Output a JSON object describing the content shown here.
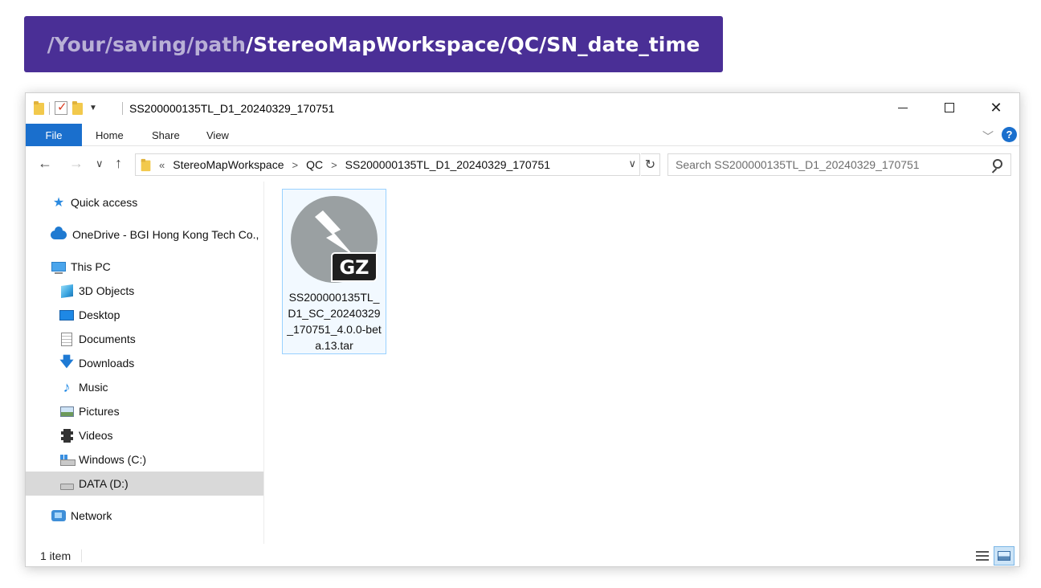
{
  "banner": {
    "prefix": "/Your/saving/path",
    "suffix": "/StereoMapWorkspace/QC/SN_date_time"
  },
  "window": {
    "title": "SS200000135TL_D1_20240329_170751",
    "controls": {
      "minimize": "—",
      "maximize": "☐",
      "close": "✕"
    }
  },
  "ribbon": {
    "tabs": [
      "File",
      "Home",
      "Share",
      "View"
    ],
    "help": "?"
  },
  "address": {
    "overflow": "«",
    "breadcrumbs": [
      "StereoMapWorkspace",
      "QC",
      "SS200000135TL_D1_20240329_170751"
    ],
    "search_placeholder": "Search SS200000135TL_D1_20240329_170751"
  },
  "navpane": {
    "quick_access": "Quick access",
    "onedrive": "OneDrive - BGI Hong Kong Tech Co.,",
    "this_pc": "This PC",
    "items": [
      "3D Objects",
      "Desktop",
      "Documents",
      "Downloads",
      "Music",
      "Pictures",
      "Videos",
      "Windows (C:)",
      "DATA (D:)"
    ],
    "network": "Network",
    "selected": "DATA (D:)"
  },
  "content": {
    "files": [
      {
        "name": "SS200000135TL_D1_SC_20240329_170751_4.0.0-beta.13.tar",
        "badge": "GZ",
        "icon": "gz-archive-icon"
      }
    ]
  },
  "status": {
    "count": "1 item"
  },
  "colors": {
    "banner": "#4a2f96",
    "file_tab": "#1a6fcd",
    "selection": "#d9d9d9"
  }
}
